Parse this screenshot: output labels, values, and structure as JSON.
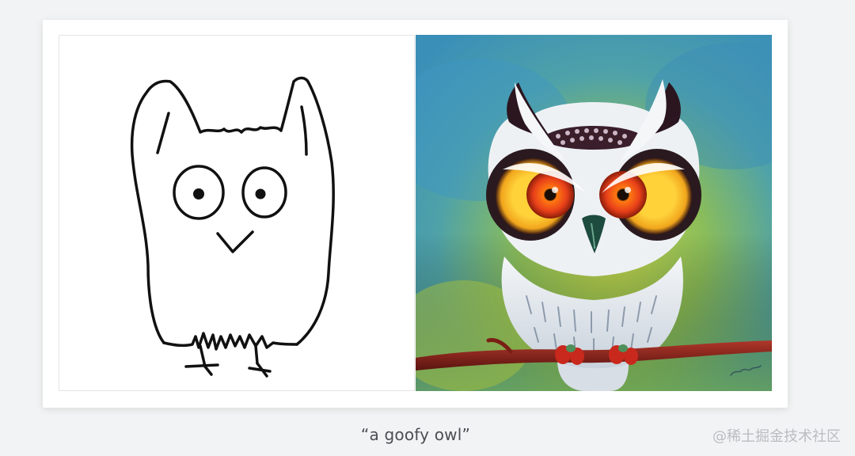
{
  "figure": {
    "caption": "“a goofy owl”",
    "watermark": "@稀土掘金技术社区",
    "images": [
      {
        "kind": "line-drawing",
        "subject": "owl"
      },
      {
        "kind": "painting",
        "subject": "owl on a branch"
      }
    ]
  }
}
